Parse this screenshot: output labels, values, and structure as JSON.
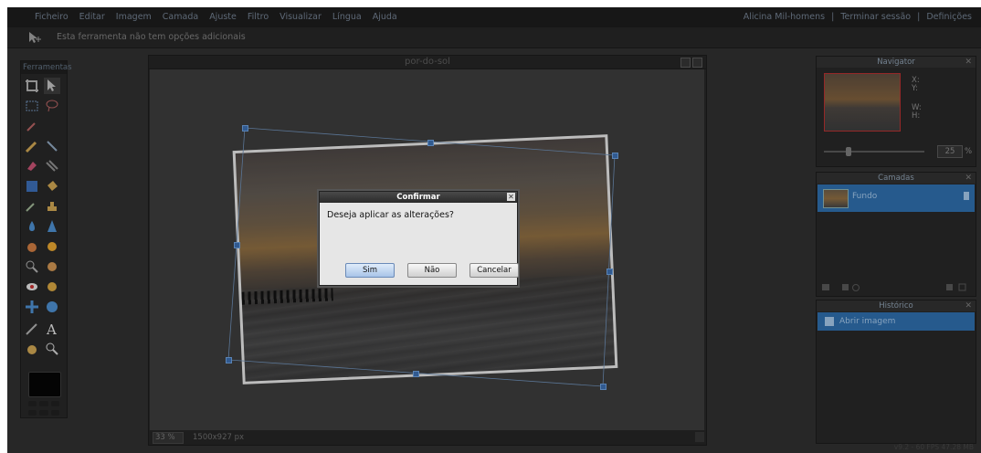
{
  "menu": [
    "Ficheiro",
    "Editar",
    "Imagem",
    "Camada",
    "Ajuste",
    "Filtro",
    "Visualizar",
    "Língua",
    "Ajuda"
  ],
  "account": {
    "user": "Alicina Mil-homens",
    "sep": "|",
    "logout": "Terminar sessão",
    "settings": "Definições"
  },
  "options_bar": {
    "text": "Esta ferramenta não tem opções adicionais"
  },
  "tools_panel": {
    "title": "Ferramentas"
  },
  "document": {
    "title": "por-do-sol",
    "zoom": "33",
    "zoom_unit": "%",
    "size": "1500x927 px"
  },
  "dialog": {
    "title": "Confirmar",
    "message": "Deseja aplicar as alterações?",
    "buttons": {
      "yes": "Sim",
      "no": "Não",
      "cancel": "Cancelar"
    }
  },
  "navigator": {
    "title": "Navigator",
    "x_label": "X:",
    "y_label": "Y:",
    "w_label": "W:",
    "h_label": "H:",
    "zoom": "25",
    "pct": "%"
  },
  "layers": {
    "title": "Camadas",
    "items": [
      {
        "name": "Fundo"
      }
    ]
  },
  "history": {
    "title": "Histórico",
    "items": [
      {
        "name": "Abrir imagem"
      }
    ]
  },
  "version": "v9.2 - 60 FPS 47.28 MB",
  "colors": {
    "accent": "#2d6aa6",
    "background": "#2e2e2e",
    "menubar": "#1c1c1c"
  }
}
